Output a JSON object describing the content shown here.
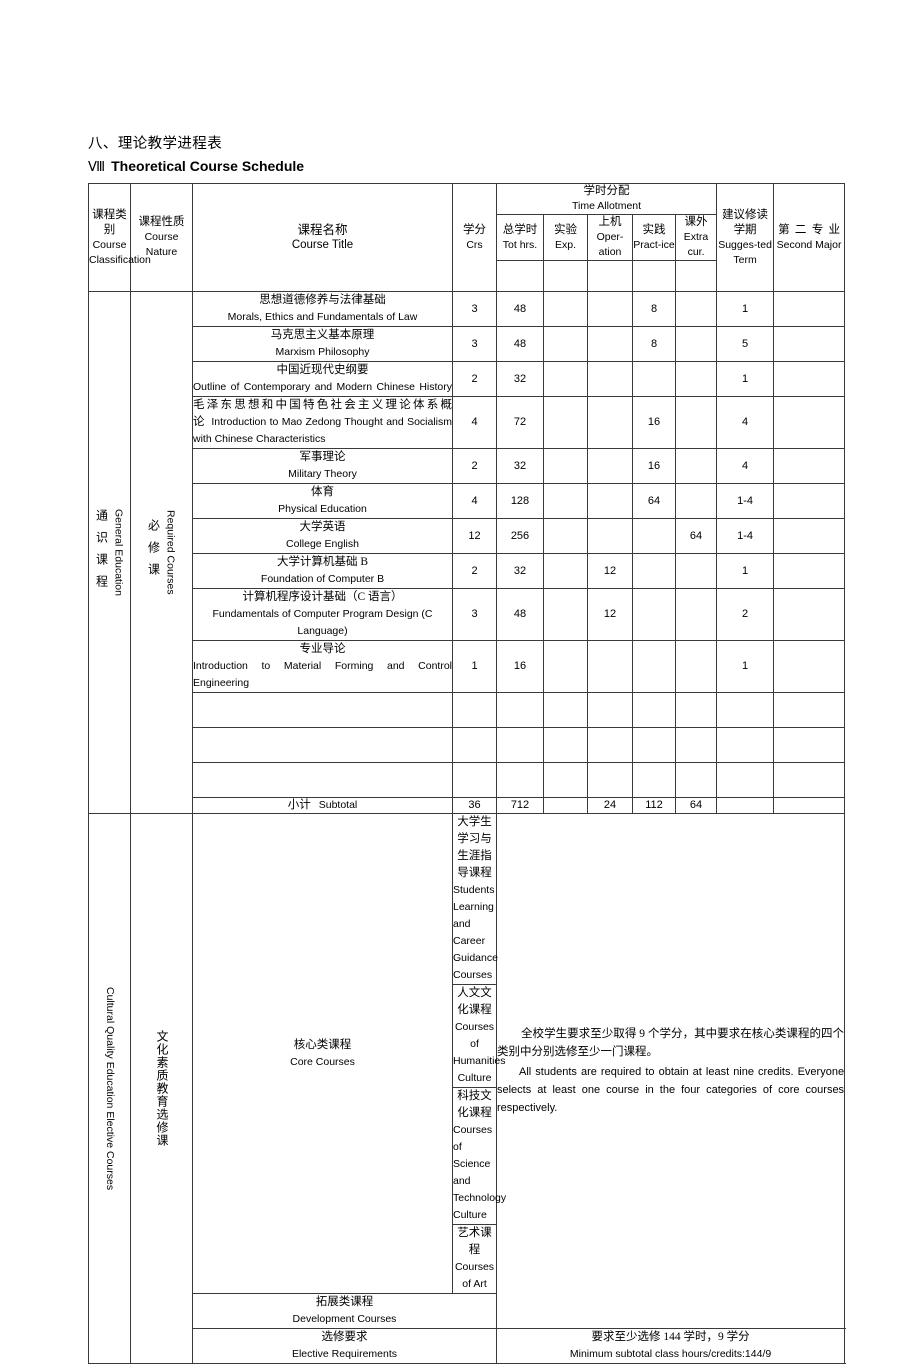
{
  "document": {
    "section_number_cn": "八、",
    "title_cn": "理论教学进程表",
    "section_numeral_en": "Ⅷ",
    "title_en": "Theoretical Course Schedule"
  },
  "table": {
    "headers": {
      "course_classification": {
        "cn": "课程类别",
        "en": "Course Classification"
      },
      "course_nature": {
        "cn": "课程性质",
        "en": "Course Nature"
      },
      "course_title": {
        "cn": "课程名称",
        "en": "Course Title"
      },
      "credits": {
        "cn": "学分",
        "en": "Crs"
      },
      "time_allotment": {
        "cn": "学时分配",
        "en": "Time Allotment"
      },
      "total_hours": {
        "cn": "总学时",
        "en": "Tot hrs."
      },
      "experiment": {
        "cn": "实验",
        "en": "Exp."
      },
      "operation": {
        "cn": "上机",
        "en": "Oper-ation"
      },
      "practice": {
        "cn": "实践",
        "en": "Pract-ice"
      },
      "extracurricular": {
        "cn": "课外",
        "en": "Extra cur."
      },
      "suggested_term": {
        "cn": "建议修读学期",
        "en": "Sugges-ted Term"
      },
      "second_major": {
        "cn": "第二专业",
        "en": "Second Major"
      }
    },
    "groups": {
      "general_education": {
        "cn": "通识课程",
        "en": "General Education"
      },
      "required_courses": {
        "cn": "必修课",
        "en": "Required Courses"
      },
      "cultural_quality": {
        "cn": "文化素质教育选修课",
        "en": "Cultural Quality Education Elective Courses"
      }
    },
    "courses": [
      {
        "cn": "思想道德修养与法律基础",
        "en": "Morals, Ethics and Fundamentals of Law",
        "credits": "3",
        "total": "48",
        "exp": "",
        "oper": "",
        "practice": "8",
        "extra": "",
        "term": "1",
        "second": ""
      },
      {
        "cn": "马克思主义基本原理",
        "en": "Marxism Philosophy",
        "credits": "3",
        "total": "48",
        "exp": "",
        "oper": "",
        "practice": "8",
        "extra": "",
        "term": "5",
        "second": ""
      },
      {
        "cn": "中国近现代史纲要",
        "en": "Outline of Contemporary and Modern Chinese History",
        "credits": "2",
        "total": "32",
        "exp": "",
        "oper": "",
        "practice": "",
        "extra": "",
        "term": "1",
        "second": ""
      },
      {
        "cn": "毛泽东思想和中国特色社会主义理论体系概论",
        "en": "Introduction to Mao Zedong Thought and Socialism with Chinese Characteristics",
        "inline": true,
        "credits": "4",
        "total": "72",
        "exp": "",
        "oper": "",
        "practice": "16",
        "extra": "",
        "term": "4",
        "second": ""
      },
      {
        "cn": "军事理论",
        "en": "Military Theory",
        "credits": "2",
        "total": "32",
        "exp": "",
        "oper": "",
        "practice": "16",
        "extra": "",
        "term": "4",
        "second": ""
      },
      {
        "cn": "体育",
        "en": "Physical Education",
        "credits": "4",
        "total": "128",
        "exp": "",
        "oper": "",
        "practice": "64",
        "extra": "",
        "term": "1-4",
        "second": ""
      },
      {
        "cn": "大学英语",
        "en": "College English",
        "credits": "12",
        "total": "256",
        "exp": "",
        "oper": "",
        "practice": "",
        "extra": "64",
        "term": "1-4",
        "second": ""
      },
      {
        "cn": "大学计算机基础 B",
        "en": "Foundation of Computer B",
        "credits": "2",
        "total": "32",
        "exp": "",
        "oper": "12",
        "practice": "",
        "extra": "",
        "term": "1",
        "second": ""
      },
      {
        "cn": "计算机程序设计基础（C 语言）",
        "en": "Fundamentals of Computer Program Design (C Language)",
        "credits": "3",
        "total": "48",
        "exp": "",
        "oper": "12",
        "practice": "",
        "extra": "",
        "term": "2",
        "second": ""
      },
      {
        "cn": "专业导论",
        "en": "Introduction to Material Forming and Control Engineering",
        "credits": "1",
        "total": "16",
        "exp": "",
        "oper": "",
        "practice": "",
        "extra": "",
        "term": "1",
        "second": ""
      },
      {
        "cn": "",
        "en": "",
        "credits": "",
        "total": "",
        "exp": "",
        "oper": "",
        "practice": "",
        "extra": "",
        "term": "",
        "second": ""
      },
      {
        "cn": "",
        "en": "",
        "credits": "",
        "total": "",
        "exp": "",
        "oper": "",
        "practice": "",
        "extra": "",
        "term": "",
        "second": ""
      },
      {
        "cn": "",
        "en": "",
        "credits": "",
        "total": "",
        "exp": "",
        "oper": "",
        "practice": "",
        "extra": "",
        "term": "",
        "second": ""
      }
    ],
    "subtotal": {
      "label_cn": "小计",
      "label_en": "Subtotal",
      "credits": "36",
      "total": "712",
      "exp": "",
      "oper": "24",
      "practice": "112",
      "extra": "64",
      "term": "",
      "second": ""
    },
    "core_courses": {
      "label_cn": "核心类课程",
      "label_en": "Core Courses",
      "items": [
        {
          "cn": "大学生学习与生涯指导课程",
          "en": "Students Learning and Career Guidance Courses"
        },
        {
          "cn": "人文文化课程",
          "en": "Courses of Humanities Culture"
        },
        {
          "cn": "科技文化课程",
          "en": "Courses of Science and Technology Culture"
        },
        {
          "cn": "艺术课程",
          "en": "Courses of Art"
        }
      ]
    },
    "development_courses": {
      "cn": "拓展类课程",
      "en": "Development Courses"
    },
    "elective_note": {
      "cn": "全校学生要求至少取得 9 个学分，其中要求在核心类课程的四个类别中分别选修至少一门课程。",
      "en": "All students are required to obtain at least nine credits. Everyone selects at least one course in the four categories of core courses respectively."
    },
    "elective_requirements": {
      "label_cn": "选修要求",
      "label_en": "Elective Requirements",
      "value_cn": "要求至少选修 144 学时，9 学分",
      "value_en": "Minimum subtotal class hours/credits:144/9"
    }
  }
}
